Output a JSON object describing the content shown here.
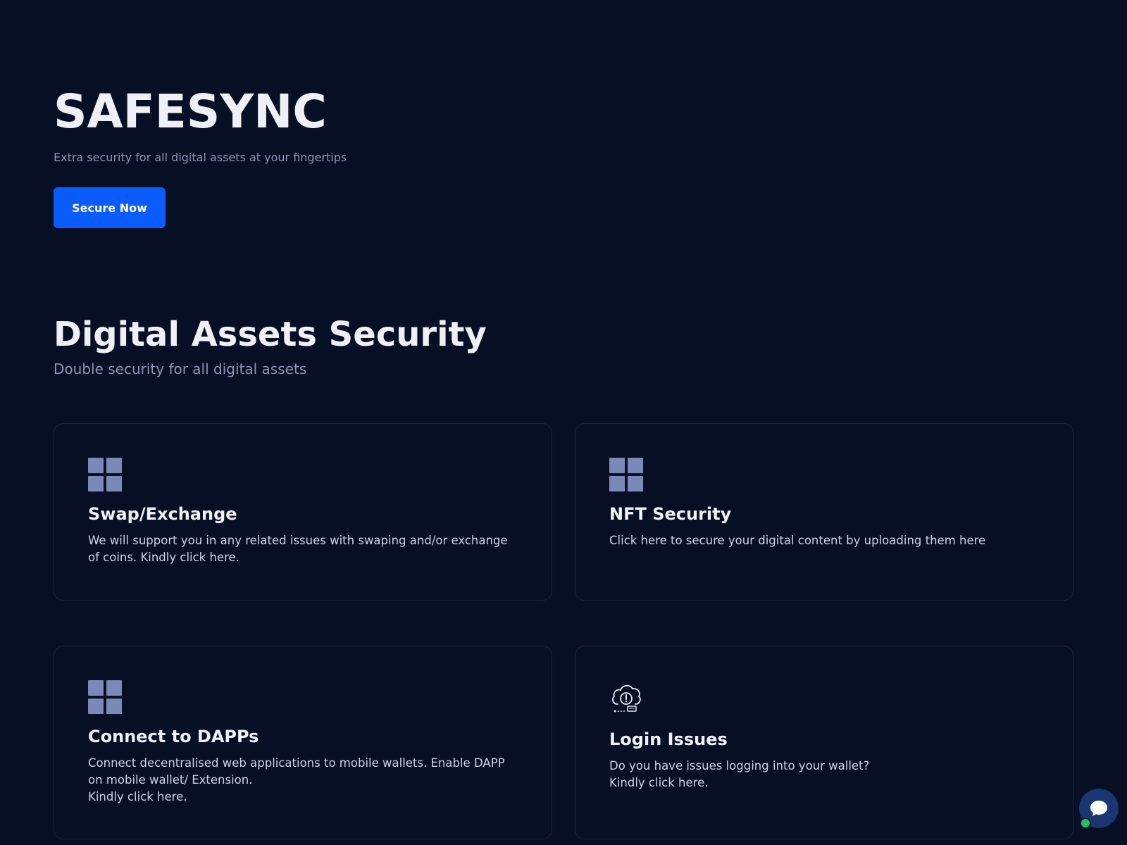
{
  "hero": {
    "title": "SAFESYNC",
    "subtitle": "Extra security for all digital assets at your fingertips",
    "cta_label": "Secure Now"
  },
  "section": {
    "title": "Digital Assets Security",
    "subtitle": "Double security for all digital assets"
  },
  "cards": [
    {
      "icon": "grid-icon",
      "title": "Swap/Exchange",
      "text": "We will support you in any related issues with swaping and/or exchange of coins. Kindly click here."
    },
    {
      "icon": "grid-icon",
      "title": "NFT Security",
      "text": "Click here to secure your digital content by uploading them here"
    },
    {
      "icon": "grid-icon",
      "title": "Connect to DAPPs",
      "text": "Connect decentralised web applications to mobile wallets. Enable DAPP on mobile wallet/ Extension.\nKindly click here."
    },
    {
      "icon": "cloud-alert-icon",
      "title": "Login Issues",
      "text": "Do you have issues logging into your wallet?\nKindly click here."
    }
  ],
  "chat": {
    "icon": "chat-bubble-icon",
    "status": "online"
  },
  "colors": {
    "background": "#070f24",
    "accent": "#0b5cff",
    "muted_text": "#8b95b7",
    "icon": "#7b89b8",
    "online": "#25c25c"
  }
}
